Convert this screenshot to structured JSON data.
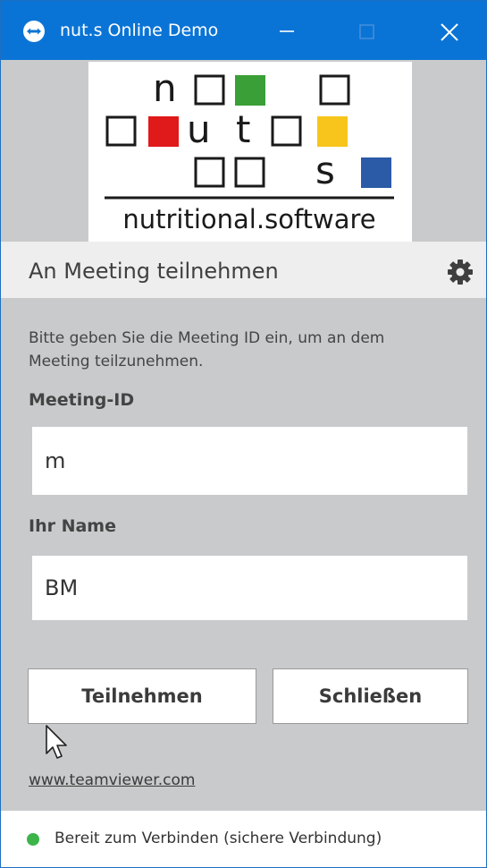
{
  "window": {
    "title": "nut.s Online Demo",
    "accent": "#0a74d6"
  },
  "logo": {
    "letters": [
      "n",
      "u",
      "t",
      "s"
    ],
    "tagline": "nutritional.software",
    "colors": {
      "green": "#3a9f37",
      "red": "#e0191b",
      "yellow": "#f7c51b",
      "blue": "#2b5aa6"
    }
  },
  "header": {
    "title": "An Meeting teilnehmen",
    "settings_icon": "gear-icon"
  },
  "form": {
    "instructions": "Bitte geben Sie die Meeting ID ein, um an dem Meeting teilzunehmen.",
    "meeting_id_label": "Meeting-ID",
    "meeting_id_value": "m",
    "name_label": "Ihr Name",
    "name_value": "BM"
  },
  "buttons": {
    "join": "Teilnehmen",
    "close": "Schließen"
  },
  "link": "www.teamviewer.com",
  "status": {
    "text": "Bereit zum Verbinden (sichere Verbindung)",
    "color": "#3cb44a"
  }
}
